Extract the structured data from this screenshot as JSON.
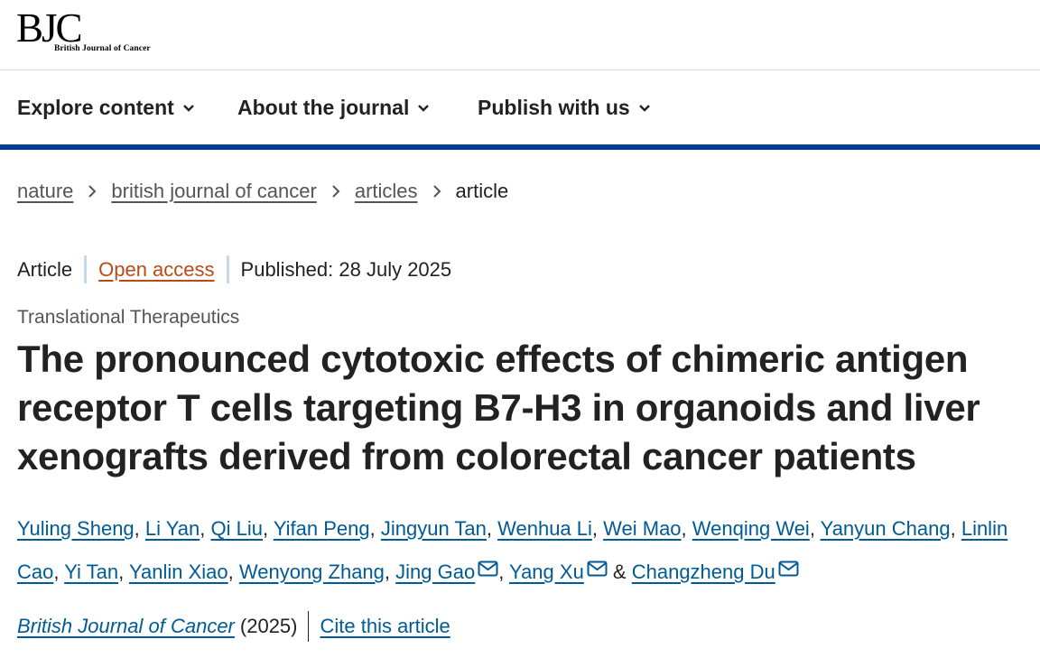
{
  "logo": {
    "main": "BJC",
    "sub": "British Journal of Cancer"
  },
  "nav": [
    {
      "label": "Explore content"
    },
    {
      "label": "About the journal"
    },
    {
      "label": "Publish with us"
    }
  ],
  "breadcrumbs": {
    "items": [
      "nature",
      "british journal of cancer",
      "articles"
    ],
    "current": "article"
  },
  "meta": {
    "type": "Article",
    "access": "Open access",
    "published": "Published: 28 July 2025"
  },
  "subject": "Translational Therapeutics",
  "title": "The pronounced cytotoxic effects of chimeric antigen receptor T cells targeting B7-H3 in organoids and liver xenografts derived from colorectal cancer patients",
  "authors": [
    "Yuling Sheng",
    "Li Yan",
    "Qi Liu",
    "Yifan Peng",
    "Jingyun Tan",
    "Wenhua Li",
    "Wei Mao",
    "Wenqing Wei",
    "Yanyun Chang",
    "Linlin Cao",
    "Yi Tan",
    "Yanlin Xiao",
    "Wenyong Zhang",
    "Jing Gao",
    "Yang Xu",
    "Changzheng Du"
  ],
  "author_separator": ",",
  "author_conjunction": "&",
  "journal": {
    "name": "British Journal of Cancer",
    "year": "(2025)",
    "cite": "Cite this article"
  },
  "colors": {
    "brand_blue": "#003d8f",
    "link": "#005a96",
    "open_access": "#b84b15"
  },
  "icons": {
    "nav_chevron": "chevron-down-icon",
    "crumb_separator": "chevron-right-icon",
    "corresponding_author": "mail-icon"
  }
}
